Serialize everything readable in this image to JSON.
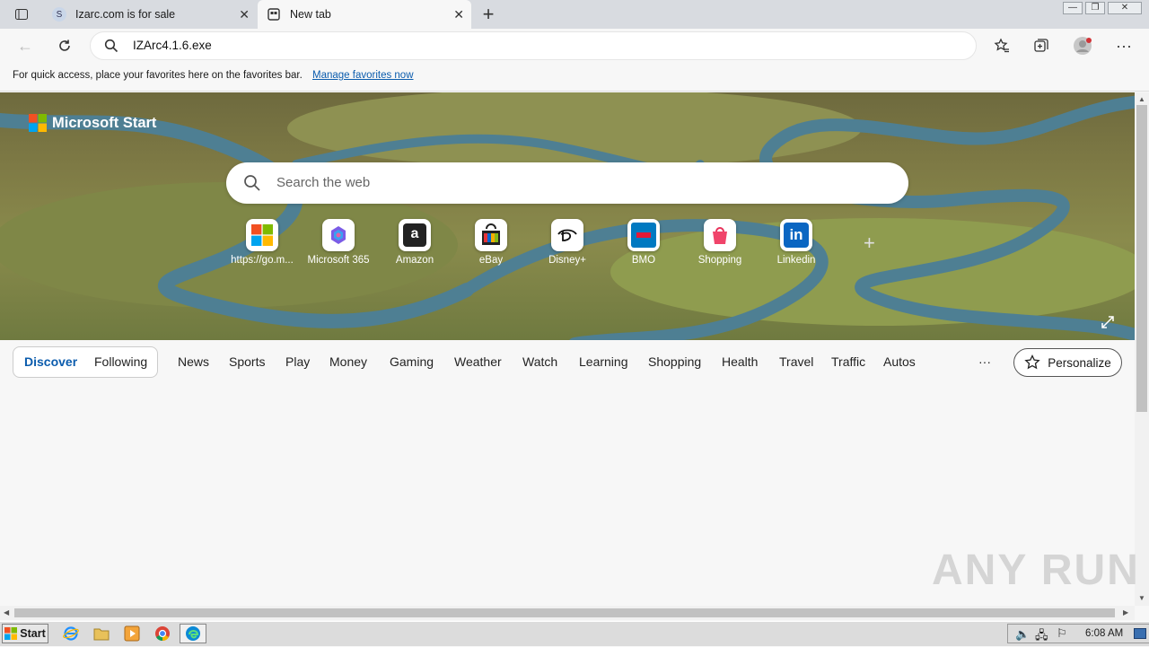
{
  "tabs": [
    {
      "title": "Izarc.com is for sale",
      "favicon": "S"
    },
    {
      "title": "New tab"
    }
  ],
  "address_bar": {
    "value": "IZArc4.1.6.exe"
  },
  "favorites_bar": {
    "message": "For quick access, place your favorites here on the favorites bar.",
    "link": "Manage favorites now"
  },
  "brand": {
    "name": "Microsoft Start"
  },
  "search": {
    "placeholder": "Search the web"
  },
  "quick_links": [
    {
      "label": "https://go.m...",
      "icon": "microsoft-logo"
    },
    {
      "label": "Microsoft 365",
      "icon": "m365-icon"
    },
    {
      "label": "Amazon",
      "icon": "amazon-icon"
    },
    {
      "label": "eBay",
      "icon": "ebay-icon"
    },
    {
      "label": "Disney+",
      "icon": "disney-icon"
    },
    {
      "label": "BMO",
      "icon": "bmo-icon"
    },
    {
      "label": "Shopping",
      "icon": "shopping-bag-icon"
    },
    {
      "label": "Linkedin",
      "icon": "linkedin-icon"
    }
  ],
  "nav": {
    "discover": "Discover",
    "following": "Following",
    "items": [
      "News",
      "Sports",
      "Play",
      "Money",
      "Gaming",
      "Weather",
      "Watch",
      "Learning",
      "Shopping",
      "Health",
      "Travel",
      "Traffic",
      "Autos"
    ],
    "more": "···",
    "personalize": "Personalize"
  },
  "taskbar": {
    "start": "Start",
    "clock": "6:08 AM"
  },
  "watermark": "ANY RUN"
}
